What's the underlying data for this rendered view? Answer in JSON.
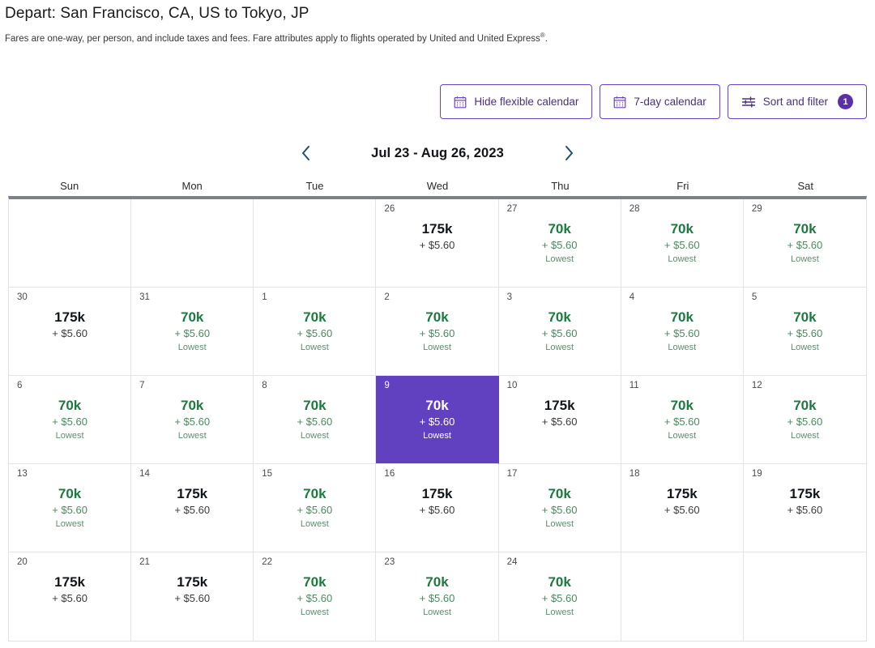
{
  "header": {
    "title": "Depart: San Francisco, CA, US to Tokyo, JP",
    "note_part1": "Fares are one-way, per person, and include taxes and fees. Fare attributes apply to flights operated by United and United Express",
    "note_sup": "®",
    "note_part2": "."
  },
  "toolbar": {
    "hide_flexible_calendar": "Hide flexible calendar",
    "seven_day_calendar": "7-day calendar",
    "sort_and_filter": "Sort and filter",
    "filter_count": "1",
    "icons": {
      "hide_flexible_calendar": "calendar-icon",
      "seven_day_calendar": "calendar-icon",
      "sort_and_filter": "sliders-icon"
    },
    "accent_color": "#6a42c2",
    "badge_color": "#5b30a6"
  },
  "date_nav": {
    "prev_icon": "chevron-left-icon",
    "next_icon": "chevron-right-icon",
    "range_label": "Jul 23 - Aug 26, 2023",
    "arrow_color": "#195174"
  },
  "calendar": {
    "weekdays": [
      "Sun",
      "Mon",
      "Tue",
      "Wed",
      "Thu",
      "Fri",
      "Sat"
    ],
    "selected_color": "#6141c0",
    "low_color": "#1c7a3e",
    "lowest_label": "Lowest",
    "rows": [
      [
        {
          "empty": true
        },
        {
          "empty": true
        },
        {
          "empty": true
        },
        {
          "day": "26",
          "miles": "175k",
          "taxes": "+ $5.60",
          "lowest": "",
          "type": "high",
          "selected": false
        },
        {
          "day": "27",
          "miles": "70k",
          "taxes": "+ $5.60",
          "lowest": "Lowest",
          "type": "low",
          "selected": false
        },
        {
          "day": "28",
          "miles": "70k",
          "taxes": "+ $5.60",
          "lowest": "Lowest",
          "type": "low",
          "selected": false
        },
        {
          "day": "29",
          "miles": "70k",
          "taxes": "+ $5.60",
          "lowest": "Lowest",
          "type": "low",
          "selected": false
        }
      ],
      [
        {
          "day": "30",
          "miles": "175k",
          "taxes": "+ $5.60",
          "lowest": "",
          "type": "high",
          "selected": false
        },
        {
          "day": "31",
          "miles": "70k",
          "taxes": "+ $5.60",
          "lowest": "Lowest",
          "type": "low",
          "selected": false
        },
        {
          "day": "1",
          "miles": "70k",
          "taxes": "+ $5.60",
          "lowest": "Lowest",
          "type": "low",
          "selected": false
        },
        {
          "day": "2",
          "miles": "70k",
          "taxes": "+ $5.60",
          "lowest": "Lowest",
          "type": "low",
          "selected": false
        },
        {
          "day": "3",
          "miles": "70k",
          "taxes": "+ $5.60",
          "lowest": "Lowest",
          "type": "low",
          "selected": false
        },
        {
          "day": "4",
          "miles": "70k",
          "taxes": "+ $5.60",
          "lowest": "Lowest",
          "type": "low",
          "selected": false
        },
        {
          "day": "5",
          "miles": "70k",
          "taxes": "+ $5.60",
          "lowest": "Lowest",
          "type": "low",
          "selected": false
        }
      ],
      [
        {
          "day": "6",
          "miles": "70k",
          "taxes": "+ $5.60",
          "lowest": "Lowest",
          "type": "low",
          "selected": false
        },
        {
          "day": "7",
          "miles": "70k",
          "taxes": "+ $5.60",
          "lowest": "Lowest",
          "type": "low",
          "selected": false
        },
        {
          "day": "8",
          "miles": "70k",
          "taxes": "+ $5.60",
          "lowest": "Lowest",
          "type": "low",
          "selected": false
        },
        {
          "day": "9",
          "miles": "70k",
          "taxes": "+ $5.60",
          "lowest": "Lowest",
          "type": "low",
          "selected": true
        },
        {
          "day": "10",
          "miles": "175k",
          "taxes": "+ $5.60",
          "lowest": "",
          "type": "high",
          "selected": false
        },
        {
          "day": "11",
          "miles": "70k",
          "taxes": "+ $5.60",
          "lowest": "Lowest",
          "type": "low",
          "selected": false
        },
        {
          "day": "12",
          "miles": "70k",
          "taxes": "+ $5.60",
          "lowest": "Lowest",
          "type": "low",
          "selected": false
        }
      ],
      [
        {
          "day": "13",
          "miles": "70k",
          "taxes": "+ $5.60",
          "lowest": "Lowest",
          "type": "low",
          "selected": false
        },
        {
          "day": "14",
          "miles": "175k",
          "taxes": "+ $5.60",
          "lowest": "",
          "type": "high",
          "selected": false
        },
        {
          "day": "15",
          "miles": "70k",
          "taxes": "+ $5.60",
          "lowest": "Lowest",
          "type": "low",
          "selected": false
        },
        {
          "day": "16",
          "miles": "175k",
          "taxes": "+ $5.60",
          "lowest": "",
          "type": "high",
          "selected": false
        },
        {
          "day": "17",
          "miles": "70k",
          "taxes": "+ $5.60",
          "lowest": "Lowest",
          "type": "low",
          "selected": false
        },
        {
          "day": "18",
          "miles": "175k",
          "taxes": "+ $5.60",
          "lowest": "",
          "type": "high",
          "selected": false
        },
        {
          "day": "19",
          "miles": "175k",
          "taxes": "+ $5.60",
          "lowest": "",
          "type": "high",
          "selected": false
        }
      ],
      [
        {
          "day": "20",
          "miles": "175k",
          "taxes": "+ $5.60",
          "lowest": "",
          "type": "high",
          "selected": false
        },
        {
          "day": "21",
          "miles": "175k",
          "taxes": "+ $5.60",
          "lowest": "",
          "type": "high",
          "selected": false
        },
        {
          "day": "22",
          "miles": "70k",
          "taxes": "+ $5.60",
          "lowest": "Lowest",
          "type": "low",
          "selected": false
        },
        {
          "day": "23",
          "miles": "70k",
          "taxes": "+ $5.60",
          "lowest": "Lowest",
          "type": "low",
          "selected": false
        },
        {
          "day": "24",
          "miles": "70k",
          "taxes": "+ $5.60",
          "lowest": "Lowest",
          "type": "low",
          "selected": false
        },
        {
          "empty": true
        },
        {
          "empty": true
        }
      ]
    ]
  }
}
